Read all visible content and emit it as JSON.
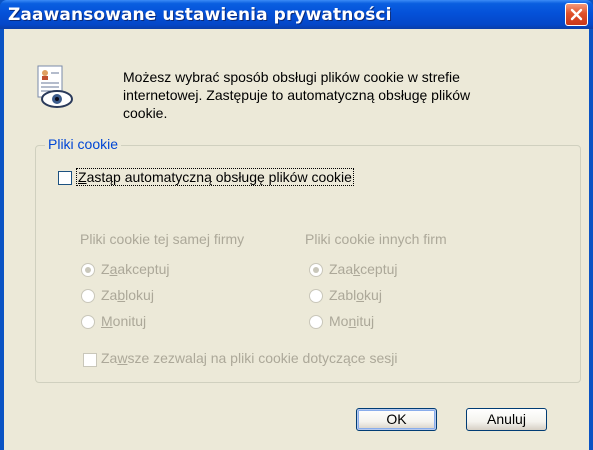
{
  "window": {
    "title": "Zaawansowane ustawienia prywatności"
  },
  "info": {
    "text_line1": "Możesz wybrać sposób obsługi plików cookie w strefie",
    "text_line2": "internetowej. Zastępuje to automatyczną obsługę plików",
    "text_line3": "cookie."
  },
  "group": {
    "label": "Pliki cookie",
    "override_label_pre": "Z",
    "override_label_rest": "astąp automatyczną obsługę plików cookie",
    "override_checked": false
  },
  "first_party": {
    "heading": "Pliki cookie tej samej firmy",
    "accept_pre": "Z",
    "accept_u": "a",
    "accept_post": "akceptuj",
    "block_pre": "Za",
    "block_u": "b",
    "block_post": "lokuj",
    "prompt_pre": "",
    "prompt_u": "M",
    "prompt_post": "onituj",
    "selected": "accept"
  },
  "third_party": {
    "heading": "Pliki cookie innych firm",
    "accept_pre": "Zaa",
    "accept_u": "k",
    "accept_post": "ceptuj",
    "block_pre": "Zabl",
    "block_u": "o",
    "block_post": "kuj",
    "prompt_pre": "Mo",
    "prompt_u": "n",
    "prompt_post": "ituj",
    "selected": "accept"
  },
  "session": {
    "label_pre": "Za",
    "label_u": "w",
    "label_post": "sze zezwalaj na pliki cookie dotyczące sesji",
    "checked": false
  },
  "buttons": {
    "ok": "OK",
    "cancel": "Anuluj"
  },
  "colors": {
    "titlebar": "#0451d9",
    "close_button": "#e0512a",
    "dialog_bg": "#ece9d8",
    "group_label": "#0046d5",
    "disabled_text": "#aca899"
  }
}
